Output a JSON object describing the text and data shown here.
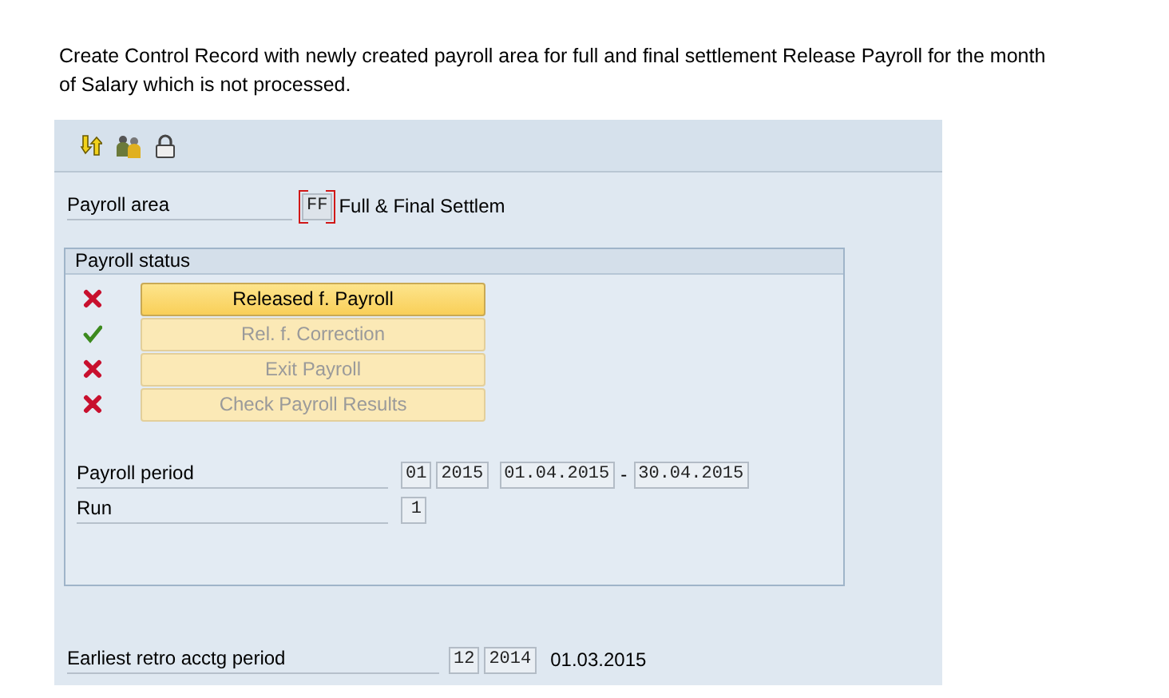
{
  "instruction": "Create Control Record with newly created payroll area for full and final settlement Release Payroll for the month of Salary which is not processed.",
  "toolbar": [
    {
      "kind": "switch"
    },
    {
      "kind": "people"
    },
    {
      "kind": "lock"
    }
  ],
  "payroll_area": {
    "label": "Payroll area",
    "value": "FF",
    "focused": true,
    "description": "Full & Final Settlem"
  },
  "payroll_status": {
    "title": "Payroll status",
    "rows": [
      {
        "done": false,
        "label": "Released f. Payroll",
        "disabled": false
      },
      {
        "done": true,
        "label": "Rel. f. Correction",
        "disabled": true
      },
      {
        "done": false,
        "label": "Exit Payroll",
        "disabled": true
      },
      {
        "done": false,
        "label": "Check Payroll Results",
        "disabled": true
      }
    ],
    "payroll_period": {
      "label": "Payroll period",
      "period": "01",
      "year": "2015",
      "from": "01.04.2015",
      "separator": "-",
      "to": "30.04.2015"
    },
    "run": {
      "label": "Run",
      "value": "1"
    }
  },
  "earliest_retro": {
    "label": "Earliest retro acctg period",
    "period": "12",
    "year": "2014",
    "date": "01.03.2015"
  }
}
